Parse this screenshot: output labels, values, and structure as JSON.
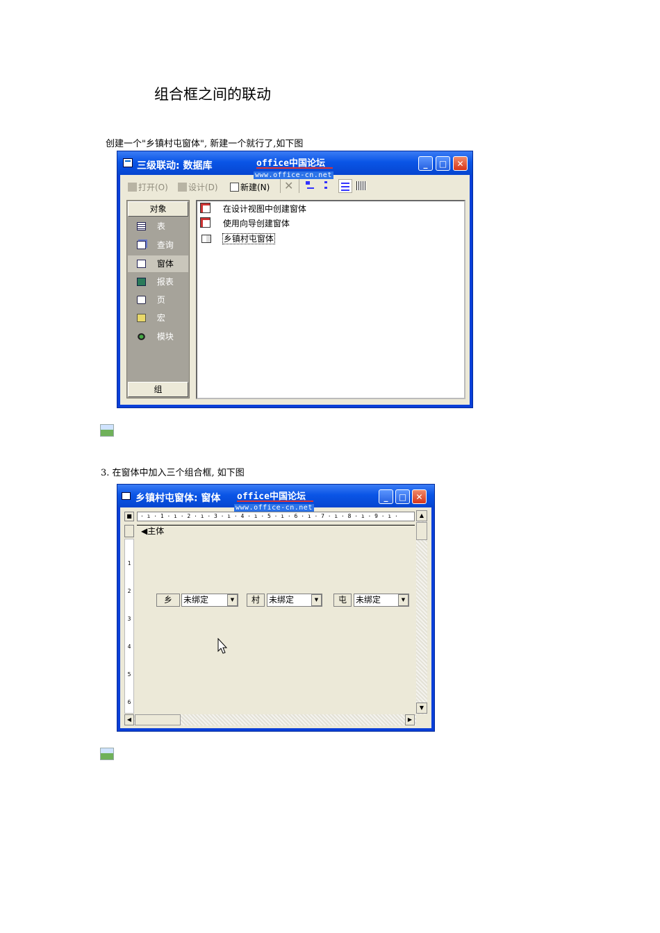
{
  "document": {
    "title": "组合框之间的联动",
    "para1": "创建一个\"乡镇村屯窗体\", 新建一个就行了,如下图",
    "para2": "3. 在窗体中加入三个组合框, 如下图"
  },
  "window1": {
    "title": "三级联动: 数据库",
    "watermark": "office中国论坛",
    "watermark_url": "www.office-cn.net",
    "toolbar": {
      "open_label": "打开(O)",
      "design_label": "设计(D)",
      "new_label": "新建(N)"
    },
    "objects_header": "对象",
    "objects": [
      {
        "label": "表",
        "icon": "table-icon"
      },
      {
        "label": "查询",
        "icon": "query-icon"
      },
      {
        "label": "窗体",
        "icon": "form-icon",
        "selected": true
      },
      {
        "label": "报表",
        "icon": "report-icon"
      },
      {
        "label": "页",
        "icon": "page-icon"
      },
      {
        "label": "宏",
        "icon": "macro-icon"
      },
      {
        "label": "模块",
        "icon": "module-icon"
      }
    ],
    "groups_label": "组",
    "list_items": [
      {
        "label": "在设计视图中创建窗体",
        "icon": "wizard-icon"
      },
      {
        "label": "使用向导创建窗体",
        "icon": "wizard-icon"
      },
      {
        "label": "乡镇村屯窗体",
        "icon": "form-icon",
        "focused": true
      }
    ]
  },
  "window2": {
    "title": "乡镇村屯窗体: 窗体",
    "watermark": "office中国论坛",
    "watermark_url": "www.office-cn.net",
    "ruler_text": "· ı · 1 · ı · 2 · ı · 3 · ı · 4 · ı · 5 · ı · 6 · ı · 7 · ı · 8 · ı · 9 · ı ·",
    "vruler_numbers": [
      "1",
      "2",
      "3",
      "4",
      "5",
      "6"
    ],
    "section_label": "主体",
    "combos": [
      {
        "label": "乡",
        "value": "未绑定"
      },
      {
        "label": "村",
        "value": "未绑定"
      },
      {
        "label": "屯",
        "value": "未绑定"
      }
    ]
  },
  "colors": {
    "titlebar": "#0a55e6",
    "client": "#ece9d8",
    "object_panel": "#a6a39a"
  }
}
